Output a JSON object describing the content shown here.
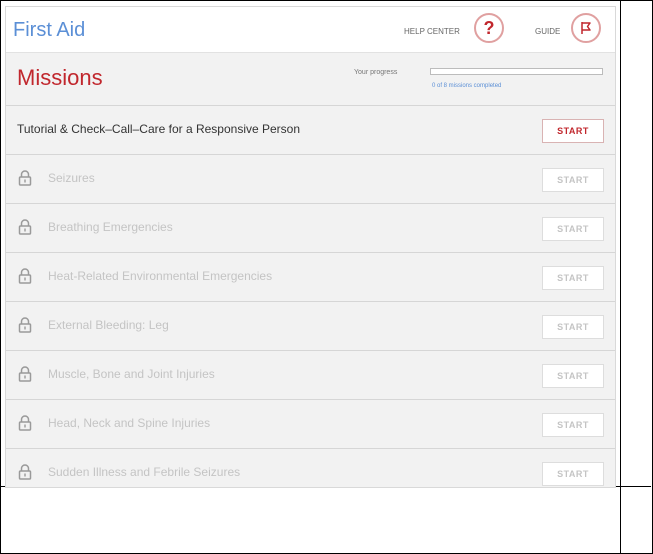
{
  "app": {
    "title": "First Aid"
  },
  "header": {
    "help_center_label": "HELP CENTER",
    "help_icon": "question-mark-icon",
    "guide_label": "GUIDE",
    "guide_icon": "flag-icon"
  },
  "missions_title": "Missions",
  "progress": {
    "label": "Your progress",
    "subtext": "0 of 8 missions completed",
    "completed": 0,
    "total": 8
  },
  "missions": [
    {
      "title": "Tutorial & Check–Call–Care for a Responsive Person",
      "locked": false,
      "start_label": "START"
    },
    {
      "title": "Seizures",
      "locked": true,
      "start_label": "START"
    },
    {
      "title": "Breathing Emergencies",
      "locked": true,
      "start_label": "START"
    },
    {
      "title": "Heat-Related Environmental Emergencies",
      "locked": true,
      "start_label": "START"
    },
    {
      "title": "External Bleeding: Leg",
      "locked": true,
      "start_label": "START"
    },
    {
      "title": "Muscle, Bone and Joint Injuries",
      "locked": true,
      "start_label": "START"
    },
    {
      "title": "Head, Neck and Spine Injuries",
      "locked": true,
      "start_label": "START"
    },
    {
      "title": "Sudden Illness and Febrile Seizures",
      "locked": true,
      "start_label": "START"
    }
  ],
  "colors": {
    "title_blue": "#5b8fd6",
    "accent_red": "#c1272d",
    "active_text": "#333333",
    "locked_text": "#c4c4c4",
    "locked_icon": "#9a9a9a"
  }
}
